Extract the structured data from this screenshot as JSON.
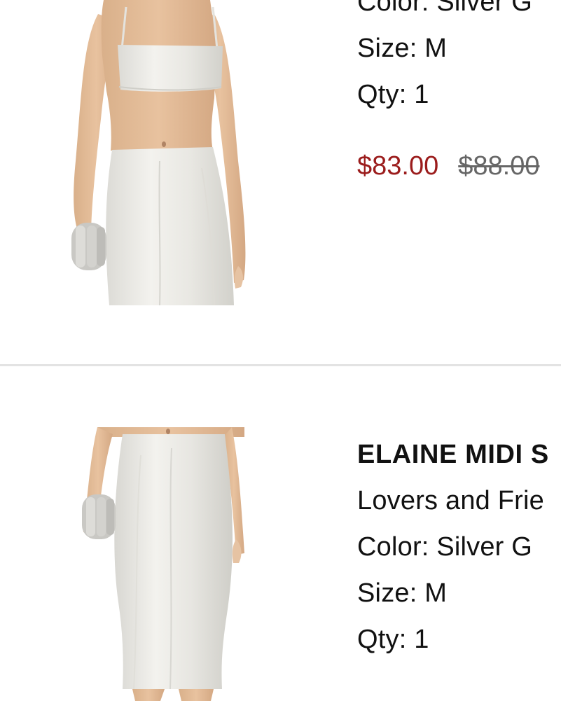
{
  "items": [
    {
      "color": "Color: Silver G",
      "size": "Size: M",
      "qty": "Qty: 1",
      "sale_price": "$83.00",
      "original_price": "$88.00"
    },
    {
      "name": "ELAINE MIDI S",
      "brand": "Lovers and Frie",
      "color": "Color: Silver G",
      "size": "Size: M",
      "qty": "Qty: 1"
    }
  ],
  "colors": {
    "sale_price": "#9b1c1c",
    "original_price": "#666666",
    "divider": "#e3e3e3",
    "garment": "#ecebe7"
  }
}
